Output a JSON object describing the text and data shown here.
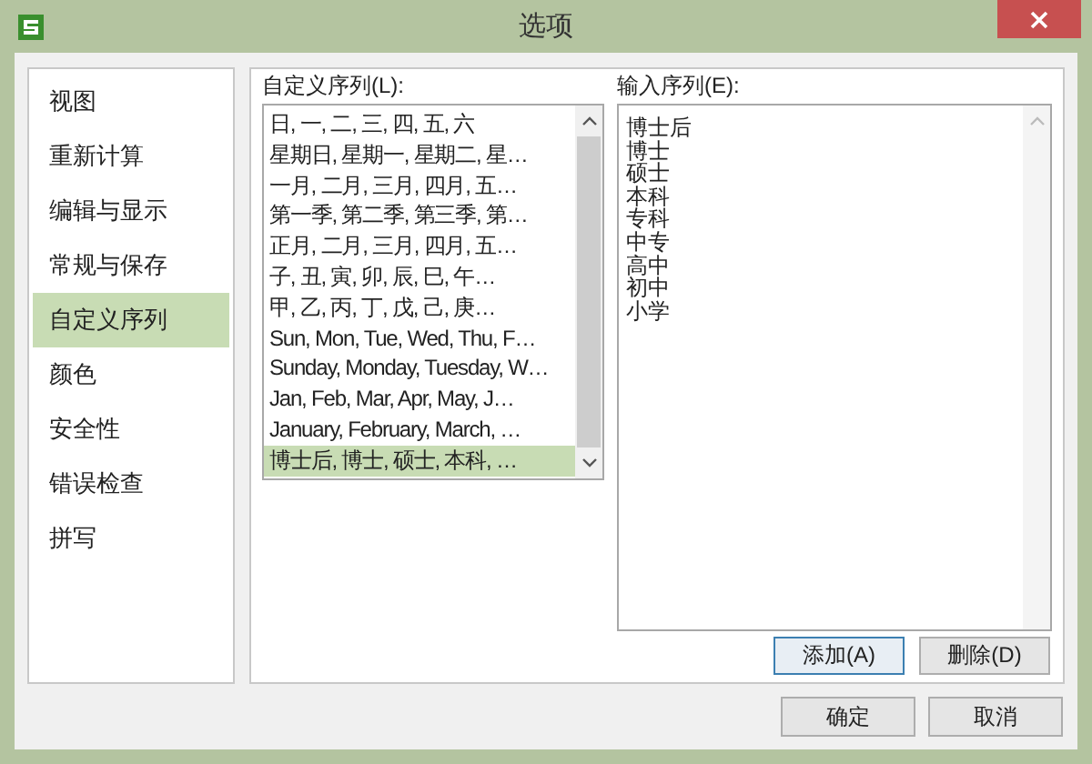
{
  "window": {
    "title": "选项"
  },
  "sidebar": {
    "items": [
      {
        "label": "视图",
        "selected": false
      },
      {
        "label": "重新计算",
        "selected": false
      },
      {
        "label": "编辑与显示",
        "selected": false
      },
      {
        "label": "常规与保存",
        "selected": false
      },
      {
        "label": "自定义序列",
        "selected": true
      },
      {
        "label": "颜色",
        "selected": false
      },
      {
        "label": "安全性",
        "selected": false
      },
      {
        "label": "错误检查",
        "selected": false
      },
      {
        "label": "拼写",
        "selected": false
      }
    ]
  },
  "custom_lists": {
    "label": "自定义序列(L):",
    "items": [
      {
        "text": "日, 一, 二, 三, 四, 五, 六",
        "selected": false
      },
      {
        "text": "星期日, 星期一, 星期二, 星…",
        "selected": false
      },
      {
        "text": "一月, 二月, 三月, 四月, 五…",
        "selected": false
      },
      {
        "text": "第一季, 第二季, 第三季, 第…",
        "selected": false
      },
      {
        "text": "正月, 二月, 三月, 四月, 五…",
        "selected": false
      },
      {
        "text": "子, 丑, 寅, 卯, 辰, 巳, 午…",
        "selected": false
      },
      {
        "text": "甲, 乙, 丙, 丁, 戊, 己, 庚…",
        "selected": false
      },
      {
        "text": "Sun, Mon, Tue, Wed, Thu, F…",
        "selected": false
      },
      {
        "text": "Sunday, Monday, Tuesday, W…",
        "selected": false
      },
      {
        "text": "Jan, Feb, Mar, Apr, May, J…",
        "selected": false
      },
      {
        "text": "January, February, March, …",
        "selected": false
      },
      {
        "text": "博士后, 博士, 硕士, 本科, …",
        "selected": true
      }
    ]
  },
  "input_list": {
    "label": "输入序列(E):",
    "lines": [
      "博士后",
      "博士",
      "硕士",
      "本科",
      "专科",
      "中专",
      "高中",
      "初中",
      "小学"
    ]
  },
  "list_buttons": [
    "添加(A)",
    "删除(D)"
  ],
  "dialog_buttons": [
    "确定",
    "取消"
  ]
}
